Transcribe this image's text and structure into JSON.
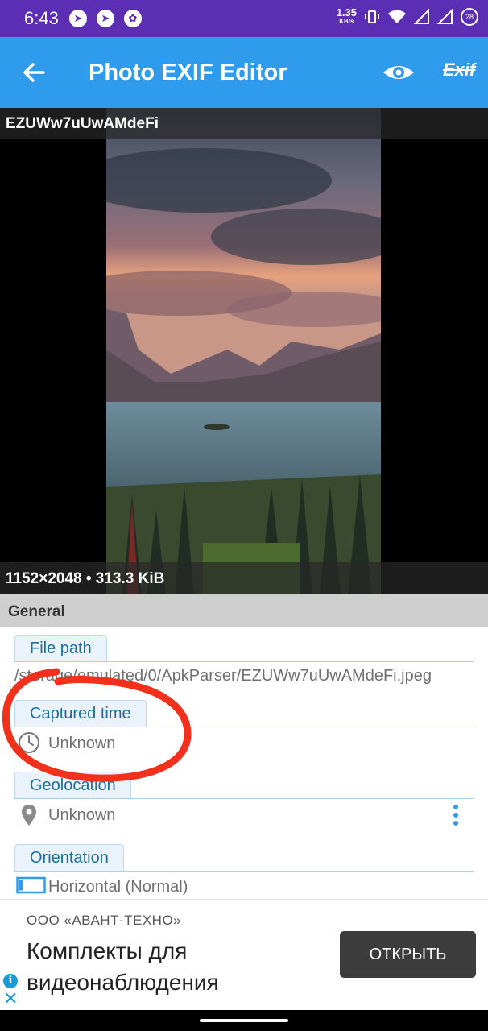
{
  "status_bar": {
    "time": "6:43",
    "net_speed": "1.35",
    "net_unit": "KB/s",
    "battery": "28"
  },
  "app_bar": {
    "title": "Photo EXIF Editor",
    "exif_label": "Exif"
  },
  "photo": {
    "filename": "EZUWw7uUwAMdeFi",
    "dimensions": "1152×2048 • 313.3 KiB"
  },
  "general": {
    "header": "General",
    "file_path": {
      "label": "File path",
      "value": "/storage/emulated/0/ApkParser/EZUWw7uUwAMdeFi.jpeg"
    },
    "captured_time": {
      "label": "Captured time",
      "value": "Unknown",
      "icon": "clock-icon"
    },
    "geolocation": {
      "label": "Geolocation",
      "value": "Unknown",
      "icon": "location-pin-icon"
    },
    "orientation": {
      "label": "Orientation",
      "value": "Horizontal (Normal)",
      "icon": "orientation-frame-icon"
    }
  },
  "ad": {
    "advertiser": "ООО «АВАНТ-ТЕХНО»",
    "headline": "Комплекты для видеонаблюдения",
    "button": "ОТКРЫТЬ"
  },
  "colors": {
    "status_bar": "#5b2eb3",
    "app_bar": "#2f9bed",
    "annotation": "#f2301b"
  }
}
